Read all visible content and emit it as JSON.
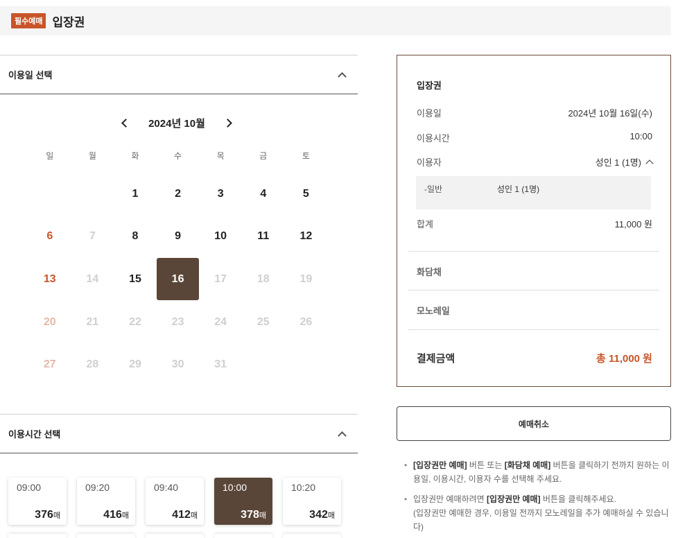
{
  "header": {
    "badge": "필수예매",
    "title": "입장권"
  },
  "date_section": {
    "title": "이용일 선택"
  },
  "calendar": {
    "month": "2024년 10월",
    "weekdays": [
      "일",
      "월",
      "화",
      "수",
      "목",
      "금",
      "토"
    ],
    "days": [
      {
        "d": "",
        "s": "empty"
      },
      {
        "d": "",
        "s": "empty"
      },
      {
        "d": "1",
        "s": "avail"
      },
      {
        "d": "2",
        "s": "avail"
      },
      {
        "d": "3",
        "s": "avail"
      },
      {
        "d": "4",
        "s": "avail"
      },
      {
        "d": "5",
        "s": "avail"
      },
      {
        "d": "6",
        "s": "sun"
      },
      {
        "d": "7",
        "s": "dis"
      },
      {
        "d": "8",
        "s": "avail"
      },
      {
        "d": "9",
        "s": "avail"
      },
      {
        "d": "10",
        "s": "avail"
      },
      {
        "d": "11",
        "s": "avail"
      },
      {
        "d": "12",
        "s": "avail"
      },
      {
        "d": "13",
        "s": "sun"
      },
      {
        "d": "14",
        "s": "dis"
      },
      {
        "d": "15",
        "s": "avail"
      },
      {
        "d": "16",
        "s": "sel"
      },
      {
        "d": "17",
        "s": "dis"
      },
      {
        "d": "18",
        "s": "dis"
      },
      {
        "d": "19",
        "s": "dis"
      },
      {
        "d": "20",
        "s": "sun-dis"
      },
      {
        "d": "21",
        "s": "dis"
      },
      {
        "d": "22",
        "s": "dis"
      },
      {
        "d": "23",
        "s": "dis"
      },
      {
        "d": "24",
        "s": "dis"
      },
      {
        "d": "25",
        "s": "dis"
      },
      {
        "d": "26",
        "s": "dis"
      },
      {
        "d": "27",
        "s": "sun-dis"
      },
      {
        "d": "28",
        "s": "dis"
      },
      {
        "d": "29",
        "s": "dis"
      },
      {
        "d": "30",
        "s": "dis"
      },
      {
        "d": "31",
        "s": "dis"
      }
    ]
  },
  "time_section": {
    "title": "이용시간 선택"
  },
  "time_slots": [
    {
      "time": "09:00",
      "count": "376",
      "unit": "매",
      "selected": false
    },
    {
      "time": "09:20",
      "count": "416",
      "unit": "매",
      "selected": false
    },
    {
      "time": "09:40",
      "count": "412",
      "unit": "매",
      "selected": false
    },
    {
      "time": "10:00",
      "count": "378",
      "unit": "매",
      "selected": true
    },
    {
      "time": "10:20",
      "count": "342",
      "unit": "매",
      "selected": false
    }
  ],
  "summary": {
    "title": "입장권",
    "date_label": "이용일",
    "date_value": "2024년 10월 16일(수)",
    "time_label": "이용시간",
    "time_value": "10:00",
    "user_label": "이용자",
    "user_value": "성인 1 (1명)",
    "sub_label": "-일반",
    "sub_value": "성인 1 (1명)",
    "total_label": "합계",
    "total_value": "11,000 원",
    "option1": "화담채",
    "option2": "모노레일",
    "pay_label": "결제금액",
    "pay_value": "총 11,000 원"
  },
  "cancel_button": "예매취소",
  "notes": {
    "n1_b1": "[입장권만 예매]",
    "n1_t1": " 버튼 또는 ",
    "n1_b2": "[화담채 예매]",
    "n1_t2": " 버튼을 클릭하기 전까지 원하는 이용일, 이용시간, 이용자 수를 선택해 주세요.",
    "n2_t1": "입장권만 예매하려면 ",
    "n2_b1": "[입장권만 예매]",
    "n2_t2": " 버튼을 클릭해주세요.",
    "n2_line2": "(입장권만 예매한 경우, 이용일 전까지 모노레일을 추가 예매하실 수 있습니다)"
  }
}
